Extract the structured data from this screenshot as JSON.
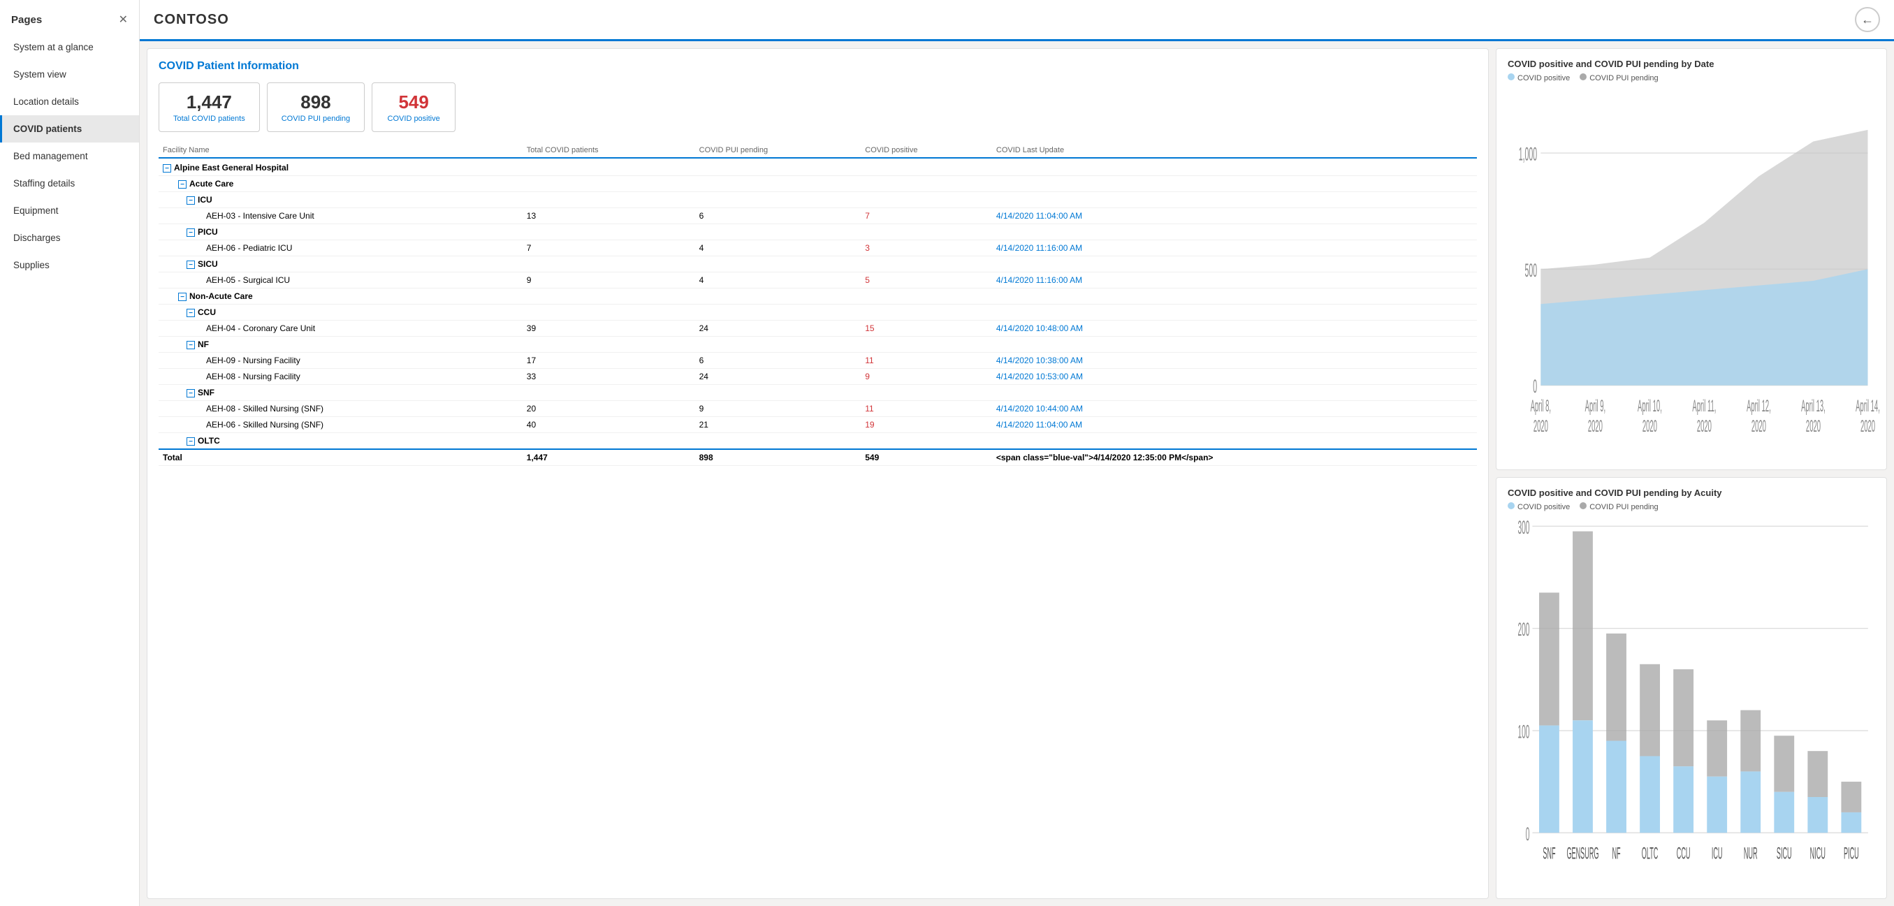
{
  "sidebar": {
    "title": "Pages",
    "items": [
      {
        "id": "system-at-glance",
        "label": "System at a glance",
        "active": false
      },
      {
        "id": "system-view",
        "label": "System view",
        "active": false
      },
      {
        "id": "location-details",
        "label": "Location details",
        "active": false
      },
      {
        "id": "covid-patients",
        "label": "COVID patients",
        "active": true
      },
      {
        "id": "bed-management",
        "label": "Bed management",
        "active": false
      },
      {
        "id": "staffing-details",
        "label": "Staffing details",
        "active": false
      },
      {
        "id": "equipment",
        "label": "Equipment",
        "active": false
      },
      {
        "id": "discharges",
        "label": "Discharges",
        "active": false
      },
      {
        "id": "supplies",
        "label": "Supplies",
        "active": false
      }
    ]
  },
  "header": {
    "title": "CONTOSO",
    "back_label": "←"
  },
  "main": {
    "panel_title": "COVID Patient Information",
    "cards": [
      {
        "value": "1,447",
        "label": "Total COVID patients",
        "red": false
      },
      {
        "value": "898",
        "label": "COVID PUI pending",
        "red": false
      },
      {
        "value": "549",
        "label": "COVID positive",
        "red": true
      }
    ],
    "table": {
      "columns": [
        "Facility Name",
        "Total COVID patients",
        "COVID PUI pending",
        "COVID positive",
        "COVID Last Update"
      ],
      "groups": [
        {
          "name": "Alpine East General Hospital",
          "subgroups": [
            {
              "name": "Acute Care",
              "subgroups": [
                {
                  "name": "ICU",
                  "rows": [
                    {
                      "facility": "AEH-03 - Intensive Care Unit",
                      "total": "13",
                      "pui": "6",
                      "positive": "7",
                      "update": "4/14/2020 11:04:00 AM"
                    }
                  ]
                },
                {
                  "name": "PICU",
                  "rows": [
                    {
                      "facility": "AEH-06 - Pediatric ICU",
                      "total": "7",
                      "pui": "4",
                      "positive": "3",
                      "update": "4/14/2020 11:16:00 AM"
                    }
                  ]
                },
                {
                  "name": "SICU",
                  "rows": [
                    {
                      "facility": "AEH-05 - Surgical ICU",
                      "total": "9",
                      "pui": "4",
                      "positive": "5",
                      "update": "4/14/2020 11:16:00 AM"
                    }
                  ]
                }
              ]
            },
            {
              "name": "Non-Acute Care",
              "subgroups": [
                {
                  "name": "CCU",
                  "rows": [
                    {
                      "facility": "AEH-04 - Coronary Care Unit",
                      "total": "39",
                      "pui": "24",
                      "positive": "15",
                      "update": "4/14/2020 10:48:00 AM"
                    }
                  ]
                },
                {
                  "name": "NF",
                  "rows": [
                    {
                      "facility": "AEH-09 - Nursing Facility",
                      "total": "17",
                      "pui": "6",
                      "positive": "11",
                      "update": "4/14/2020 10:38:00 AM"
                    },
                    {
                      "facility": "AEH-08 - Nursing Facility",
                      "total": "33",
                      "pui": "24",
                      "positive": "9",
                      "update": "4/14/2020 10:53:00 AM"
                    }
                  ]
                },
                {
                  "name": "SNF",
                  "rows": [
                    {
                      "facility": "AEH-08 - Skilled Nursing (SNF)",
                      "total": "20",
                      "pui": "9",
                      "positive": "11",
                      "update": "4/14/2020 10:44:00 AM"
                    },
                    {
                      "facility": "AEH-06 - Skilled Nursing (SNF)",
                      "total": "40",
                      "pui": "21",
                      "positive": "19",
                      "update": "4/14/2020 11:04:00 AM"
                    }
                  ]
                },
                {
                  "name": "OLTC",
                  "rows": []
                }
              ]
            }
          ]
        }
      ],
      "total_row": {
        "label": "Total",
        "total": "1,447",
        "pui": "898",
        "positive": "549",
        "update": "4/14/2020 12:35:00 PM"
      }
    }
  },
  "charts": {
    "line_chart": {
      "title": "COVID positive and COVID PUI pending by Date",
      "legend": [
        {
          "label": "COVID positive",
          "color": "blue"
        },
        {
          "label": "COVID PUI pending",
          "color": "gray"
        }
      ],
      "x_labels": [
        "April 8, 2020",
        "April 9, 2020",
        "April 10,\n2020",
        "April 11,\n2020",
        "April 12,\n2020",
        "April 13,\n2020",
        "April 14,\n2020"
      ],
      "y_labels": [
        "0",
        "500",
        "1,000"
      ],
      "positive_data": [
        350,
        370,
        390,
        410,
        430,
        450,
        500
      ],
      "pui_data": [
        500,
        520,
        550,
        700,
        900,
        1050,
        1100
      ]
    },
    "bar_chart": {
      "title": "COVID positive and COVID PUI pending by Acuity",
      "legend": [
        {
          "label": "COVID positive",
          "color": "blue"
        },
        {
          "label": "COVID PUI pending",
          "color": "gray"
        }
      ],
      "y_labels": [
        "0",
        "100",
        "200",
        "300"
      ],
      "bars": [
        {
          "label": "SNF",
          "positive": 105,
          "pui": 130
        },
        {
          "label": "GENSURG",
          "positive": 110,
          "pui": 185
        },
        {
          "label": "NF",
          "positive": 90,
          "pui": 105
        },
        {
          "label": "OLTC",
          "positive": 75,
          "pui": 90
        },
        {
          "label": "CCU",
          "positive": 65,
          "pui": 95
        },
        {
          "label": "ICU",
          "positive": 55,
          "pui": 55
        },
        {
          "label": "NUR",
          "positive": 60,
          "pui": 60
        },
        {
          "label": "SICU",
          "positive": 40,
          "pui": 55
        },
        {
          "label": "NICU",
          "positive": 35,
          "pui": 45
        },
        {
          "label": "PICU",
          "positive": 20,
          "pui": 30
        }
      ]
    }
  }
}
